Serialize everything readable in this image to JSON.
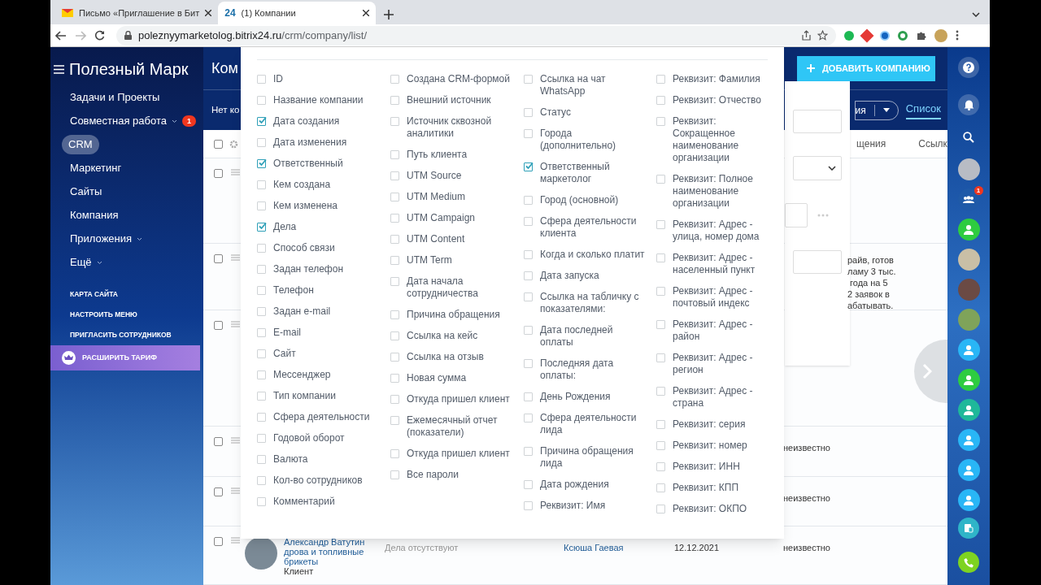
{
  "browser": {
    "tabs": [
      {
        "title": "Письмо «Приглашение в Бит",
        "kind": "mail",
        "selected": false
      },
      {
        "title": "(1) Компании",
        "kind": "bitrix",
        "icon_text": "24",
        "selected": true
      }
    ],
    "url_host": "poleznyymarketolog.bitrix24.ru",
    "url_path": "/crm/company/list/"
  },
  "sidebar": {
    "title": "Полезный Марк",
    "items": [
      {
        "label": "Задачи и Проекты",
        "selected": false,
        "expandable": false
      },
      {
        "label": "Совместная работа",
        "selected": false,
        "expandable": true,
        "counter": "1"
      },
      {
        "label": "CRM",
        "selected": true,
        "expandable": false
      },
      {
        "label": "Маркетинг",
        "selected": false,
        "expandable": false
      },
      {
        "label": "Сайты",
        "selected": false,
        "expandable": false
      },
      {
        "label": "Компания",
        "selected": false,
        "expandable": false
      },
      {
        "label": "Приложения",
        "selected": false,
        "expandable": true
      },
      {
        "label": "Ещё",
        "selected": false,
        "expandable": true
      }
    ],
    "links": [
      "КАРТА САЙТА",
      "НАСТРОИТЬ МЕНЮ",
      "ПРИГЛАСИТЬ СОТРУДНИКОВ"
    ],
    "upgrade_button": "РАСШИРИТЬ ТАРИФ"
  },
  "header": {
    "title": "Ком",
    "add_button": "ДОБАВИТЬ КОМПАНИЮ",
    "toolbar_text": "Нет ко",
    "filter_text": "ия",
    "view_tab": "Список"
  },
  "table": {
    "select_all": false,
    "columns": [
      "щения",
      "Ссылк"
    ],
    "rows": [
      {
        "checked": false
      },
      {
        "checked": false,
        "description": "райв, готов\nламу 3 тыс.\n года на 5\n2 заявок в\nабатывать."
      },
      {
        "checked": false
      },
      {
        "checked": false,
        "status": "неизвестно"
      },
      {
        "checked": false,
        "status": "неизвестно"
      },
      {
        "checked": false,
        "company": "Александр Ватутин",
        "company_detail": "дрова и топливные брикеты",
        "company_type": "Клиент",
        "activity": "Дела отсутствуют",
        "responsible": "Ксюша Гаевая",
        "date": "12.12.2021",
        "status": "неизвестно"
      }
    ]
  },
  "popup": {
    "columns": [
      {
        "items": [
          {
            "label": "ID",
            "checked": false
          },
          {
            "label": "Название компании",
            "checked": false
          },
          {
            "label": "Дата создания",
            "checked": true
          },
          {
            "label": "Дата изменения",
            "checked": false
          },
          {
            "label": "Ответственный",
            "checked": true
          },
          {
            "label": "Кем создана",
            "checked": false
          },
          {
            "label": "Кем изменена",
            "checked": false
          },
          {
            "label": "Дела",
            "checked": true
          },
          {
            "label": "Способ связи",
            "checked": false
          },
          {
            "label": "Задан телефон",
            "checked": false
          },
          {
            "label": "Телефон",
            "checked": false
          },
          {
            "label": "Задан e-mail",
            "checked": false
          },
          {
            "label": "E-mail",
            "checked": false
          },
          {
            "label": "Сайт",
            "checked": false
          },
          {
            "label": "Мессенджер",
            "checked": false
          },
          {
            "label": "Тип компании",
            "checked": false
          },
          {
            "label": "Сфера деятельности",
            "checked": false
          },
          {
            "label": "Годовой оборот",
            "checked": false
          },
          {
            "label": "Валюта",
            "checked": false
          },
          {
            "label": "Кол-во сотрудников",
            "checked": false
          },
          {
            "label": "Комментарий",
            "checked": false
          }
        ]
      },
      {
        "items": [
          {
            "label": "Создана CRM-формой",
            "checked": false
          },
          {
            "label": "Внешний источник",
            "checked": false
          },
          {
            "label": "Источник сквозной аналитики",
            "checked": false
          },
          {
            "label": "Путь клиента",
            "checked": false
          },
          {
            "label": "UTM Source",
            "checked": false
          },
          {
            "label": "UTM Medium",
            "checked": false
          },
          {
            "label": "UTM Campaign",
            "checked": false
          },
          {
            "label": "UTM Content",
            "checked": false
          },
          {
            "label": "UTM Term",
            "checked": false
          },
          {
            "label": "Дата начала сотрудничества",
            "checked": false
          },
          {
            "label": "Причина обращения",
            "checked": false
          },
          {
            "label": "Ссылка на кейс",
            "checked": false
          },
          {
            "label": "Ссылка на отзыв",
            "checked": false
          },
          {
            "label": "Новая сумма",
            "checked": false
          },
          {
            "label": "Откуда пришел клиент",
            "checked": false
          },
          {
            "label": "Ежемесячный отчет (показатели)",
            "checked": false
          },
          {
            "label": "Откуда пришел клиент",
            "checked": false
          },
          {
            "label": "Все пароли",
            "checked": false
          }
        ]
      },
      {
        "items": [
          {
            "label": "Ссылка на чат WhatsApp",
            "checked": false
          },
          {
            "label": "Статус",
            "checked": false
          },
          {
            "label": "Города (дополнительно)",
            "checked": false
          },
          {
            "label": "Ответственный маркетолог",
            "checked": true
          },
          {
            "label": "Город (основной)",
            "checked": false
          },
          {
            "label": "Сфера деятельности клиента",
            "checked": false
          },
          {
            "label": "Когда и сколько платит",
            "checked": false
          },
          {
            "label": "Дата запуска",
            "checked": false
          },
          {
            "label": "Ссылка на табличку с показателями:",
            "checked": false
          },
          {
            "label": "Дата последней оплаты",
            "checked": false
          },
          {
            "label": "Последняя дата оплаты:",
            "checked": false
          },
          {
            "label": "День Рождения",
            "checked": false
          },
          {
            "label": "Сфера деятельности лида",
            "checked": false
          },
          {
            "label": "Причина обращения лида",
            "checked": false
          },
          {
            "label": "Дата рождения",
            "checked": false
          },
          {
            "label": "Реквизит: Имя",
            "checked": false
          }
        ]
      },
      {
        "items": [
          {
            "label": "Реквизит: Фамилия",
            "checked": false
          },
          {
            "label": "Реквизит: Отчество",
            "checked": false
          },
          {
            "label": "Реквизит: Сокращенное наименование организации",
            "checked": false
          },
          {
            "label": "Реквизит: Полное наименование организации",
            "checked": false
          },
          {
            "label": "Реквизит: Адрес - улица, номер дома",
            "checked": false
          },
          {
            "label": "Реквизит: Адрес - населенный пункт",
            "checked": false
          },
          {
            "label": "Реквизит: Адрес - почтовый индекс",
            "checked": false
          },
          {
            "label": "Реквизит: Адрес - район",
            "checked": false
          },
          {
            "label": "Реквизит: Адрес - регион",
            "checked": false
          },
          {
            "label": "Реквизит: Адрес - страна",
            "checked": false
          },
          {
            "label": "Реквизит: серия",
            "checked": false
          },
          {
            "label": "Реквизит: номер",
            "checked": false
          },
          {
            "label": "Реквизит: ИНН",
            "checked": false
          },
          {
            "label": "Реквизит: КПП",
            "checked": false
          },
          {
            "label": "Реквизит: ОКПО",
            "checked": false
          }
        ]
      }
    ]
  },
  "right_bar": {
    "contacts": [
      {
        "kind": "photo",
        "color": "#b8bcc4"
      },
      {
        "kind": "group",
        "color": "#1f5aa8",
        "counter": "1"
      },
      {
        "kind": "user",
        "color": "#2ecc40"
      },
      {
        "kind": "photo",
        "color": "#c9bfa6"
      },
      {
        "kind": "photo",
        "color": "#6b4a44"
      },
      {
        "kind": "photo",
        "color": "#7fa35a"
      },
      {
        "kind": "waiting",
        "color": "#29b6f6"
      },
      {
        "kind": "user",
        "color": "#2ecc40"
      },
      {
        "kind": "user",
        "color": "#1fb89a"
      },
      {
        "kind": "waiting",
        "color": "#29b6f6"
      },
      {
        "kind": "waiting",
        "color": "#29b6f6"
      },
      {
        "kind": "waiting",
        "color": "#29b6f6"
      }
    ]
  }
}
